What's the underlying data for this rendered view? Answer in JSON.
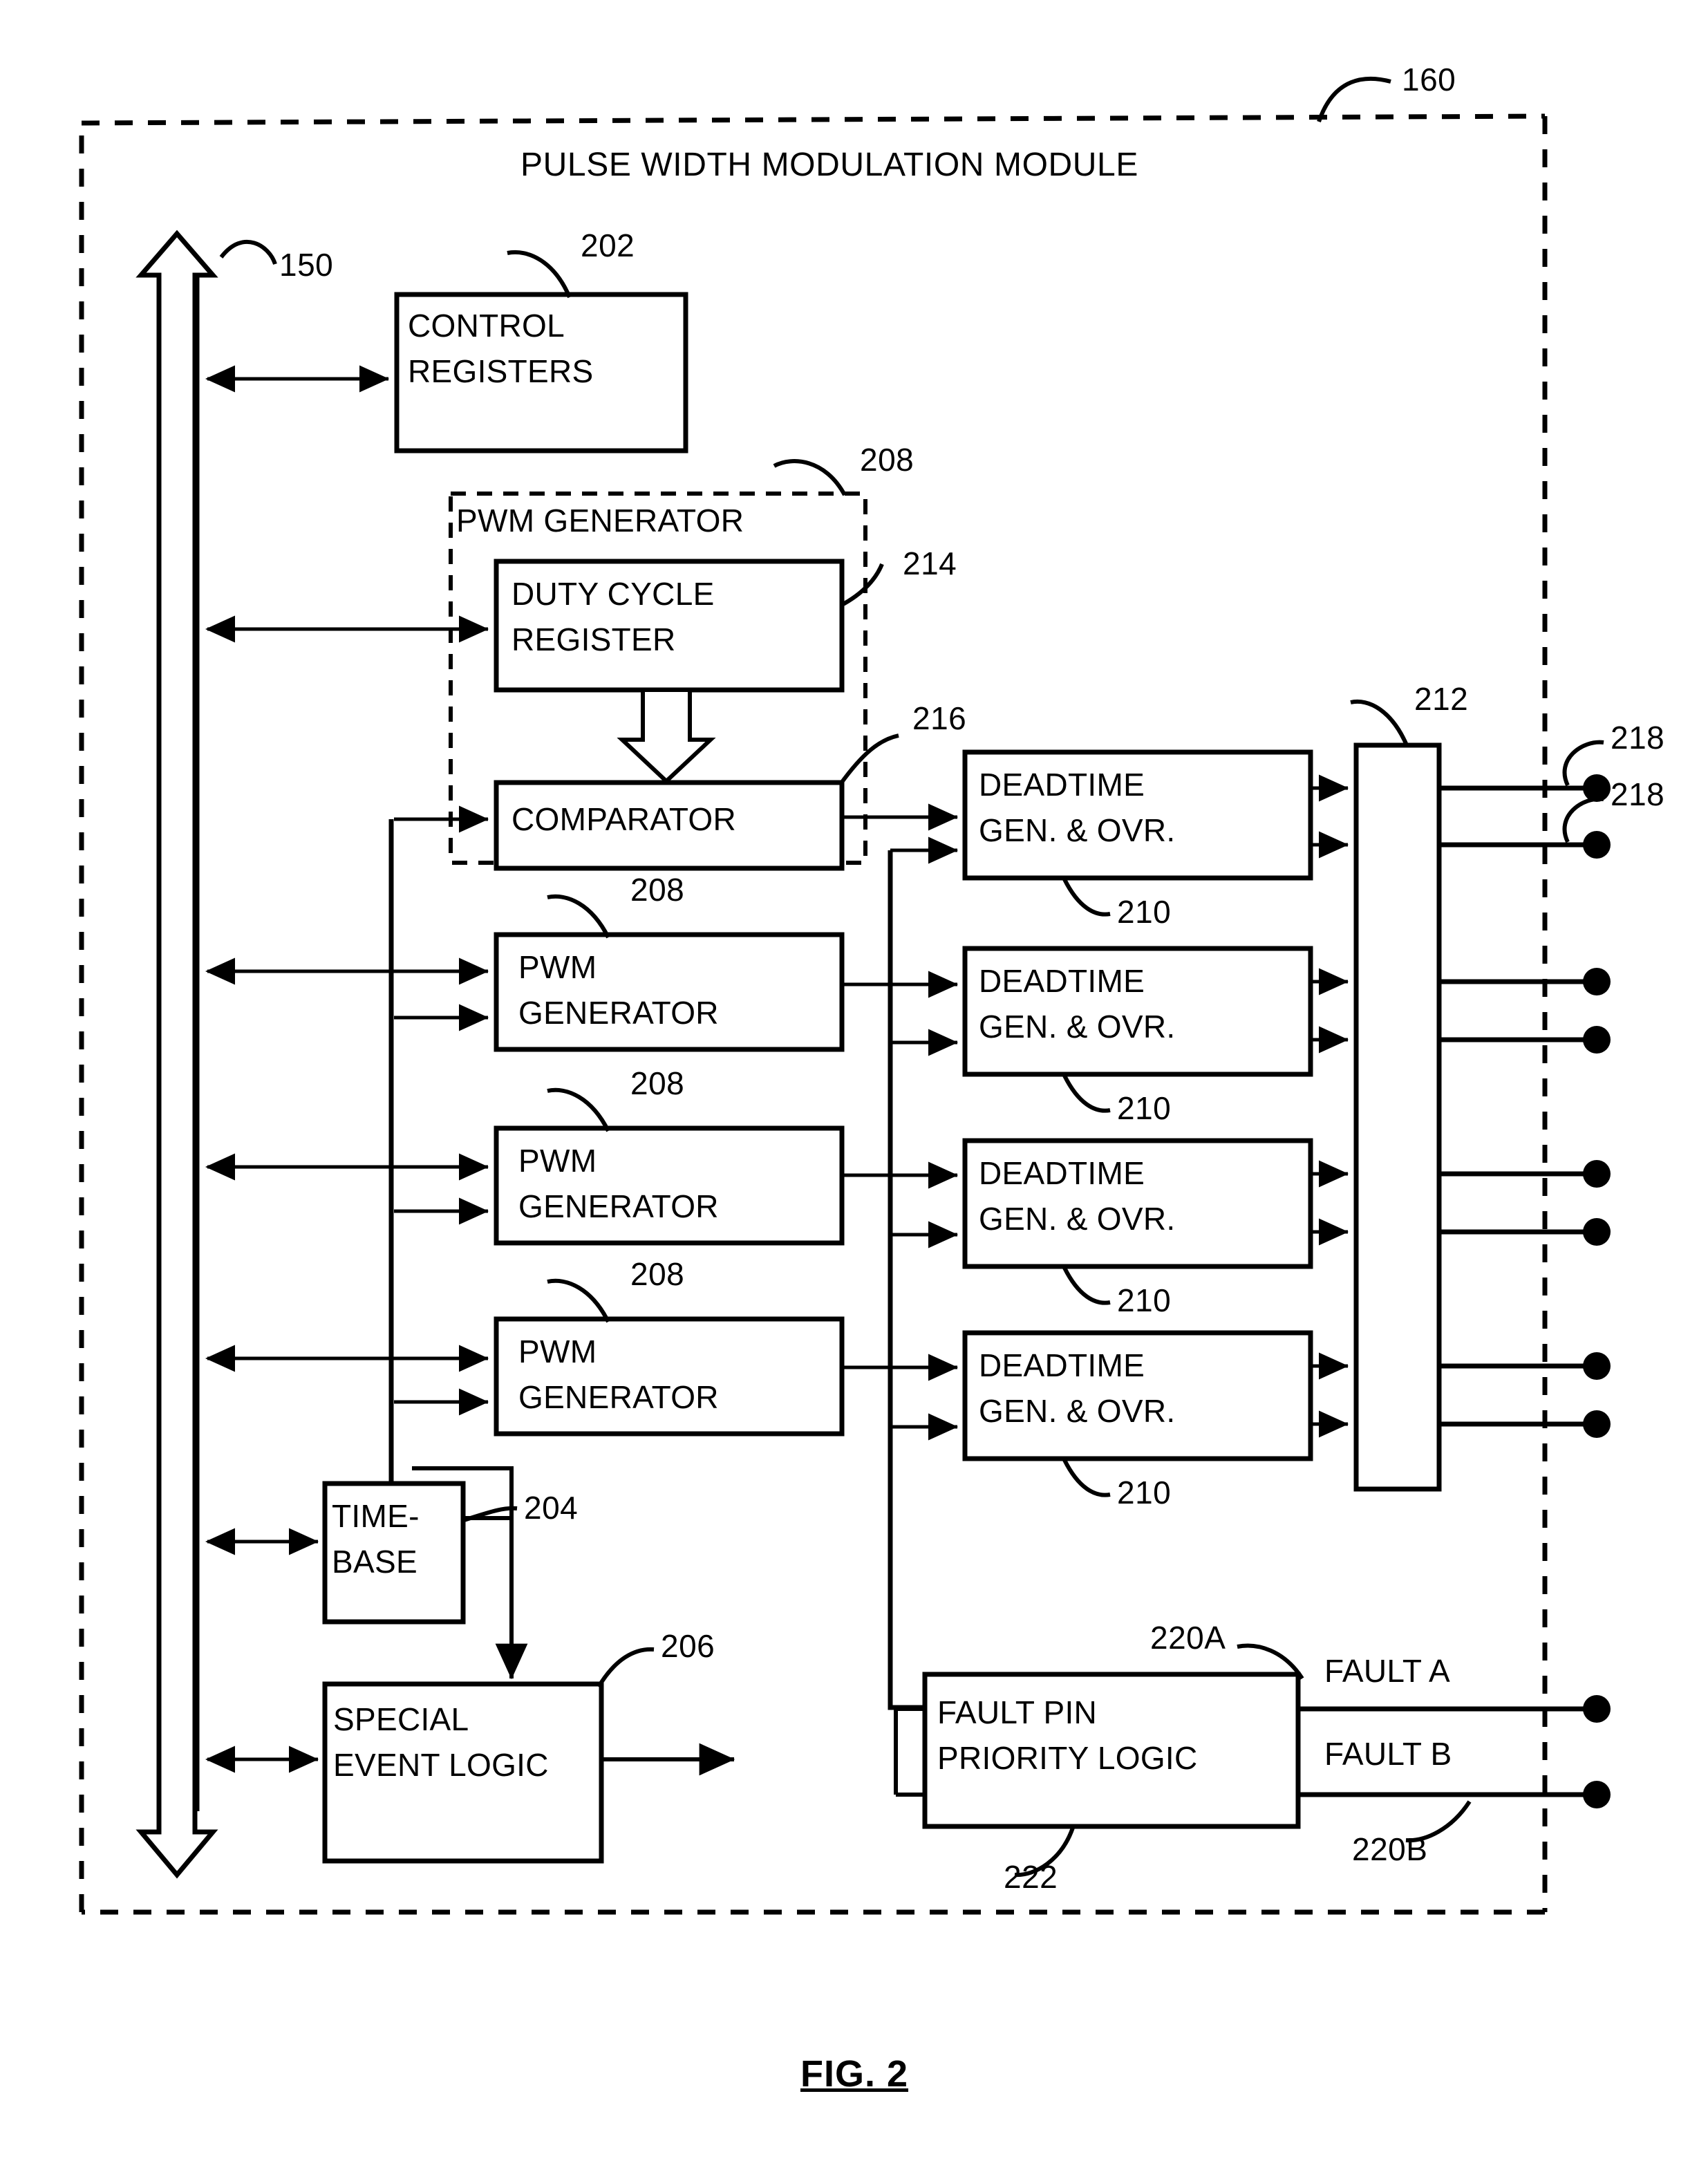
{
  "figure": {
    "caption": "FIG. 2",
    "module_title": "PULSE WIDTH MODULATION MODULE",
    "module_ref": "160"
  },
  "bus": {
    "ref": "150"
  },
  "blocks": {
    "control_registers": {
      "line1": "CONTROL",
      "line2": "REGISTERS",
      "ref": "202"
    },
    "pwm_generator_group": {
      "label": "PWM GENERATOR",
      "ref": "208"
    },
    "duty_cycle_register": {
      "line1": "DUTY CYCLE",
      "line2": "REGISTER",
      "ref": "214"
    },
    "comparator": {
      "label": "COMPARATOR",
      "ref": "216"
    },
    "pwm_generator_2": {
      "line1": "PWM",
      "line2": "GENERATOR",
      "ref": "208"
    },
    "pwm_generator_3": {
      "line1": "PWM",
      "line2": "GENERATOR",
      "ref": "208"
    },
    "pwm_generator_4": {
      "line1": "PWM",
      "line2": "GENERATOR",
      "ref": "208"
    },
    "deadtime_1": {
      "line1": "DEADTIME",
      "line2": "GEN. & OVR.",
      "ref": "210"
    },
    "deadtime_2": {
      "line1": "DEADTIME",
      "line2": "GEN. & OVR.",
      "ref": "210"
    },
    "deadtime_3": {
      "line1": "DEADTIME",
      "line2": "GEN. & OVR.",
      "ref": "210"
    },
    "deadtime_4": {
      "line1": "DEADTIME",
      "line2": "GEN. & OVR.",
      "ref": "210"
    },
    "output_driver": {
      "ref": "212"
    },
    "timebase": {
      "line1": "TIME-",
      "line2": "BASE",
      "ref": "204"
    },
    "special_event_logic": {
      "line1": "SPECIAL",
      "line2": "EVENT LOGIC",
      "ref": "206"
    },
    "fault_pin_priority_logic": {
      "line1": "FAULT PIN",
      "line2": "PRIORITY LOGIC",
      "ref": "222"
    }
  },
  "pins": {
    "pwm_output_ref_top": "218",
    "pwm_output_ref_second": "218",
    "fault_a_label": "FAULT A",
    "fault_a_ref": "220A",
    "fault_b_label": "FAULT B",
    "fault_b_ref": "220B"
  },
  "colors": {
    "ink": "#000000",
    "paper": "#ffffff"
  }
}
